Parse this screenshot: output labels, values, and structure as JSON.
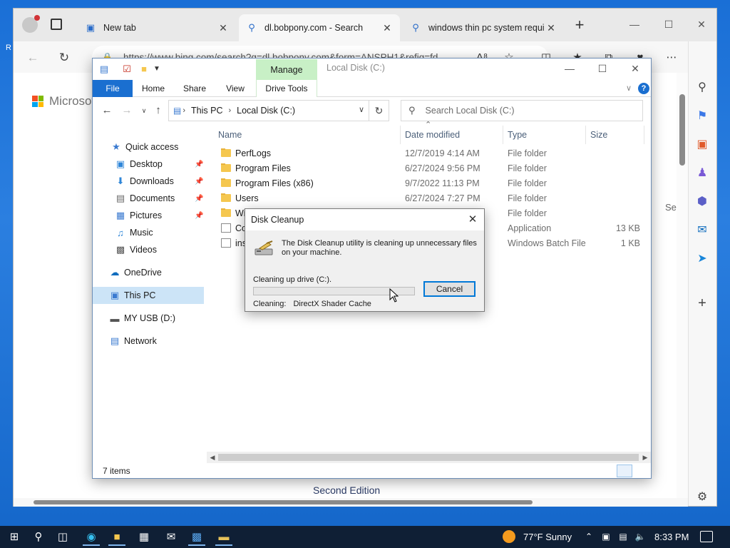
{
  "browser": {
    "tabs": [
      {
        "label": "New tab",
        "icon": "newtab-icon"
      },
      {
        "label": "dl.bobpony.com - Search",
        "icon": "search-icon"
      },
      {
        "label": "windows thin pc system requi",
        "icon": "search-icon"
      }
    ],
    "address": "https://www.bing.com/search?q=dl.bobpony.com&form=ANSPH1&refig=fd...",
    "see_more": "See m",
    "second_edition": "Second Edition",
    "logo_text": "Microsoft"
  },
  "explorer": {
    "manage_label": "Manage",
    "window_title": "Local Disk (C:)",
    "ribbon_tabs": [
      "File",
      "Home",
      "Share",
      "View",
      "Drive Tools"
    ],
    "breadcrumb": [
      "This PC",
      "Local Disk (C:)"
    ],
    "search_placeholder": "Search Local Disk (C:)",
    "columns": [
      "Name",
      "Date modified",
      "Type",
      "Size"
    ],
    "nav": [
      {
        "label": "Quick access",
        "icon": "star-icon",
        "pinned": false
      },
      {
        "label": "Desktop",
        "icon": "desktop-icon",
        "pinned": true
      },
      {
        "label": "Downloads",
        "icon": "download-icon",
        "pinned": true
      },
      {
        "label": "Documents",
        "icon": "document-icon",
        "pinned": true
      },
      {
        "label": "Pictures",
        "icon": "picture-icon",
        "pinned": true
      },
      {
        "label": "Music",
        "icon": "music-icon",
        "pinned": false
      },
      {
        "label": "Videos",
        "icon": "video-icon",
        "pinned": false
      },
      {
        "label": "OneDrive",
        "icon": "cloud-icon",
        "pinned": false
      },
      {
        "label": "This PC",
        "icon": "pc-icon",
        "pinned": false
      },
      {
        "label": "MY USB (D:)",
        "icon": "usb-drive-icon",
        "pinned": false
      },
      {
        "label": "Network",
        "icon": "network-icon",
        "pinned": false
      }
    ],
    "files": [
      {
        "name": "PerfLogs",
        "date": "12/7/2019 4:14 AM",
        "type": "File folder",
        "size": ""
      },
      {
        "name": "Program Files",
        "date": "6/27/2024 9:56 PM",
        "type": "File folder",
        "size": ""
      },
      {
        "name": "Program Files (x86)",
        "date": "9/7/2022 11:13 PM",
        "type": "File folder",
        "size": ""
      },
      {
        "name": "Users",
        "date": "6/27/2024 7:27 PM",
        "type": "File folder",
        "size": ""
      },
      {
        "name": "Wi",
        "date": "",
        "type": "File folder",
        "size": ""
      },
      {
        "name": "Co",
        "date": "",
        "type": "Application",
        "size": "13 KB"
      },
      {
        "name": "ins",
        "date": "",
        "type": "Windows Batch File",
        "size": "1 KB"
      }
    ],
    "status": "7 items"
  },
  "dialog": {
    "title": "Disk Cleanup",
    "message": "The Disk Cleanup utility is cleaning up unnecessary files on your machine.",
    "drive_label": "Cleaning up drive  (C:).",
    "progress": 0.0,
    "cancel_label": "Cancel",
    "cleaning_label": "Cleaning:",
    "cleaning_value": "DirectX Shader Cache"
  },
  "taskbar": {
    "weather": "77°F  Sunny",
    "time": "8:33 PM"
  },
  "colors": {
    "accent": "#1a6fd0",
    "manage_tab": "#c8f0c6",
    "selected_nav": "#cce4f7",
    "taskbar": "#0f1f35"
  }
}
